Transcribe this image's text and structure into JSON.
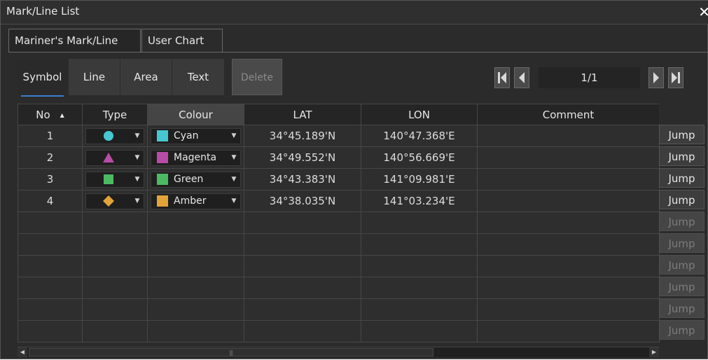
{
  "window": {
    "title": "Mark/Line List",
    "close_glyph": "✕"
  },
  "tabs": [
    {
      "label": "Mariner's Mark/Line"
    },
    {
      "label": "User Chart"
    }
  ],
  "subtabs": [
    {
      "label": "Symbol"
    },
    {
      "label": "Line"
    },
    {
      "label": "Area"
    },
    {
      "label": "Text"
    }
  ],
  "delete_label": "Delete",
  "pager": {
    "page": "1/1"
  },
  "table": {
    "headers": {
      "no": "No",
      "type": "Type",
      "colour": "Colour",
      "lat": "LAT",
      "lon": "LON",
      "comment": "Comment"
    },
    "rows": [
      {
        "no": "1",
        "shape": "circle",
        "colour": "Cyan",
        "colour_hex": "#47c8d1",
        "lat": "34°45.189'N",
        "lon": "140°47.368'E",
        "comment": ""
      },
      {
        "no": "2",
        "shape": "triangle",
        "colour": "Magenta",
        "colour_hex": "#b84ca6",
        "lat": "34°49.552'N",
        "lon": "140°56.669'E",
        "comment": ""
      },
      {
        "no": "3",
        "shape": "square",
        "colour": "Green",
        "colour_hex": "#4cba63",
        "lat": "34°43.383'N",
        "lon": "141°09.981'E",
        "comment": ""
      },
      {
        "no": "4",
        "shape": "diamond",
        "colour": "Amber",
        "colour_hex": "#e2a339",
        "lat": "34°38.035'N",
        "lon": "141°03.234'E",
        "comment": ""
      }
    ]
  },
  "jump": {
    "label": "Jump"
  }
}
